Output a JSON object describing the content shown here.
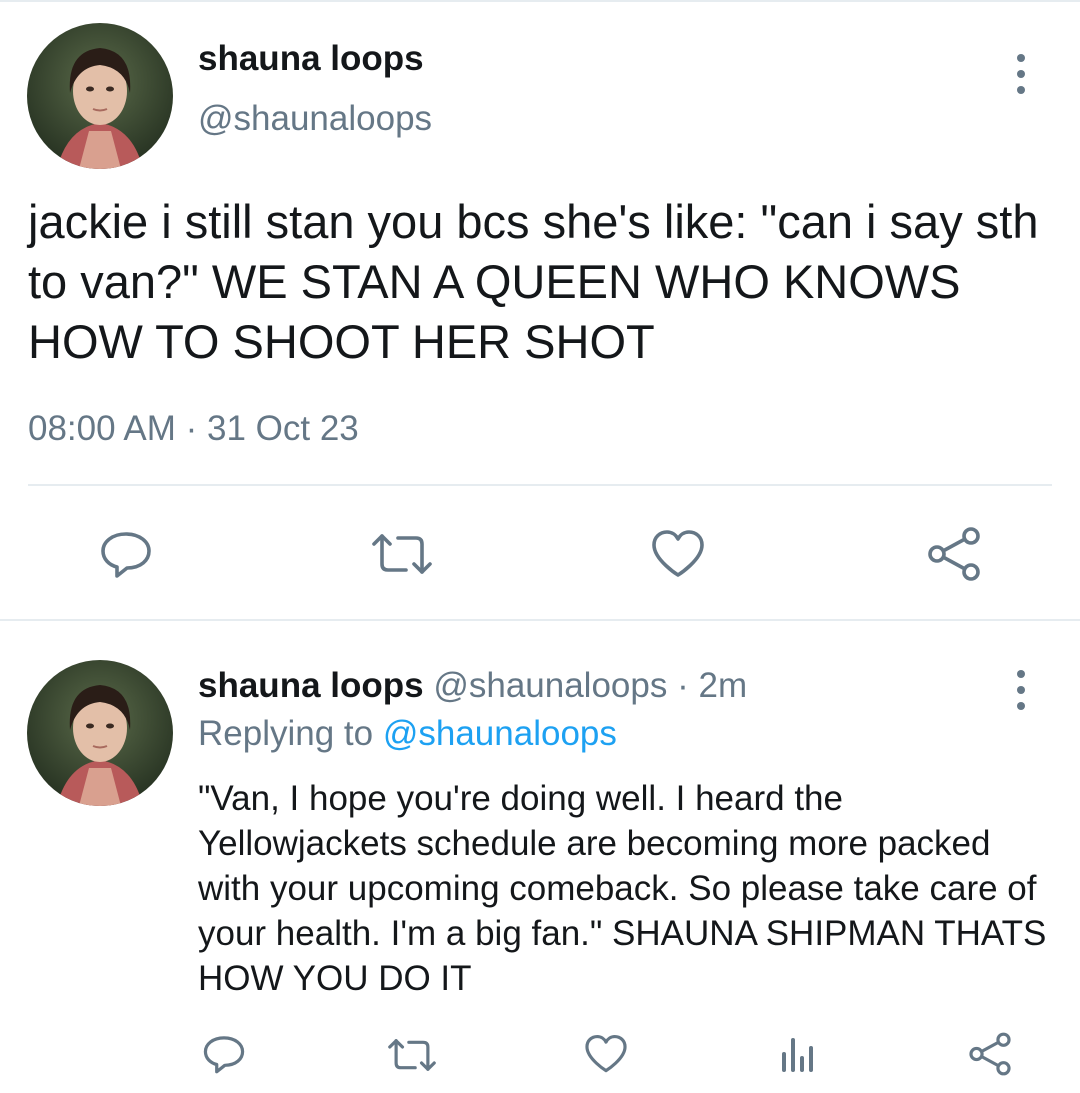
{
  "colors": {
    "text_primary": "#14171a",
    "text_secondary": "#657786",
    "link": "#1da1f2",
    "divider": "#e6ecf0"
  },
  "main_tweet": {
    "display_name": "shauna loops",
    "handle": "@shaunaloops",
    "text": "jackie i still stan you bcs she's like: \"can i say sth to van?\" WE STAN A QUEEN WHO KNOWS HOW TO SHOOT HER SHOT",
    "time": "08:00 AM",
    "separator": "·",
    "date": "31 Oct 23",
    "actions": [
      "reply-icon",
      "retweet-icon",
      "like-icon",
      "share-icon"
    ]
  },
  "reply_tweet": {
    "display_name": "shauna loops",
    "handle": "@shaunaloops",
    "separator": "·",
    "age": "2m",
    "replying_label": "Replying to",
    "replying_handle": "@shaunaloops",
    "text": "\"Van, I hope you're doing well. I heard the Yellowjackets schedule are becoming more packed with your upcoming comeback. So please take care of your health. I'm a big fan.\" SHAUNA SHIPMAN THATS HOW YOU DO IT",
    "actions": [
      "reply-icon",
      "retweet-icon",
      "like-icon",
      "analytics-icon",
      "share-icon"
    ]
  }
}
